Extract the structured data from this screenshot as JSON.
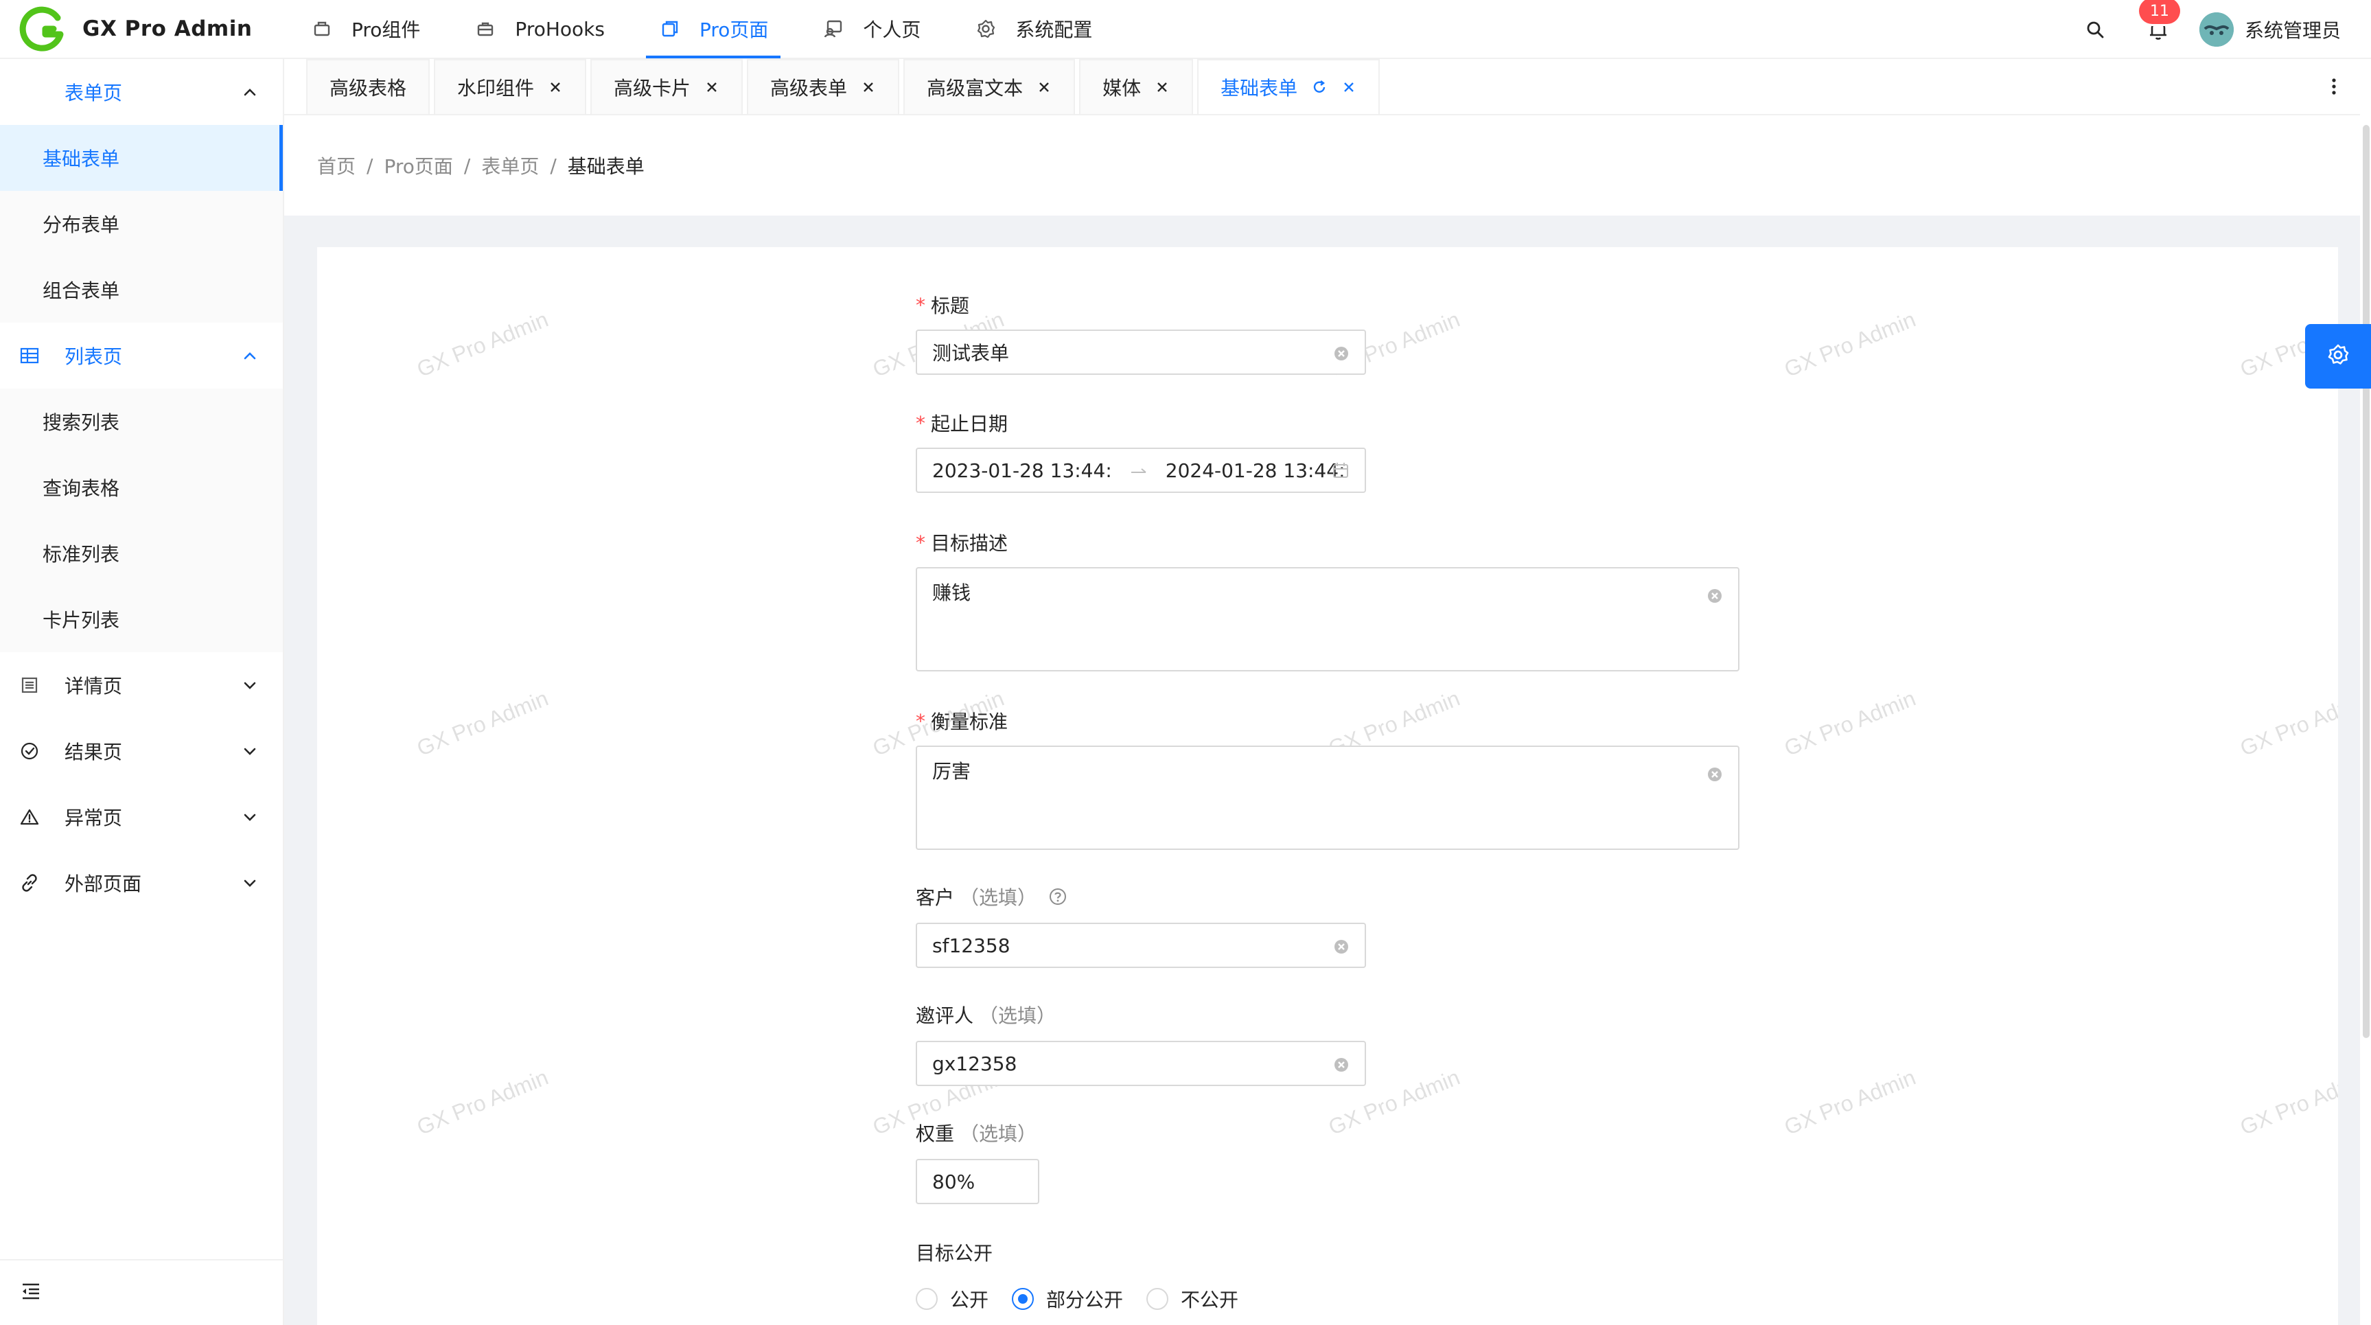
{
  "app": {
    "title": "GX Pro Admin",
    "accent_color": "#1677ff"
  },
  "topnav": [
    {
      "label": "Pro组件",
      "icon": "component-icon",
      "active": false
    },
    {
      "label": "ProHooks",
      "icon": "briefcase-icon",
      "active": false
    },
    {
      "label": "Pro页面",
      "icon": "pages-icon",
      "active": true
    },
    {
      "label": "个人页",
      "icon": "user-card-icon",
      "active": false
    },
    {
      "label": "系统配置",
      "icon": "gear-icon",
      "active": false
    }
  ],
  "header": {
    "notification_count": "11",
    "user_name": "系统管理员"
  },
  "sidebar": {
    "groups": [
      {
        "label": "表单页",
        "icon": "",
        "open": true,
        "items": [
          "基础表单",
          "分布表单",
          "组合表单"
        ],
        "selected": "基础表单"
      },
      {
        "label": "列表页",
        "icon": "table-icon",
        "open": true,
        "items": [
          "搜索列表",
          "查询表格",
          "标准列表",
          "卡片列表"
        ]
      },
      {
        "label": "详情页",
        "icon": "profile-icon",
        "open": false
      },
      {
        "label": "结果页",
        "icon": "check-circle-icon",
        "open": false
      },
      {
        "label": "异常页",
        "icon": "warning-icon",
        "open": false
      },
      {
        "label": "外部页面",
        "icon": "link-icon",
        "open": false
      }
    ]
  },
  "tabs": [
    {
      "label": "高级表格",
      "closable": false
    },
    {
      "label": "水印组件",
      "closable": true
    },
    {
      "label": "高级卡片",
      "closable": true
    },
    {
      "label": "高级表单",
      "closable": true
    },
    {
      "label": "高级富文本",
      "closable": true
    },
    {
      "label": "媒体",
      "closable": true
    },
    {
      "label": "基础表单",
      "closable": true,
      "active": true
    }
  ],
  "breadcrumb": [
    "首页",
    "Pro页面",
    "表单页",
    "基础表单"
  ],
  "form": {
    "title": {
      "label": "标题",
      "required": true,
      "value": "测试表单"
    },
    "date_range": {
      "label": "起止日期",
      "required": true,
      "start": "2023-01-28 13:44:",
      "end": "2024-01-28 13:44:"
    },
    "goal": {
      "label": "目标描述",
      "required": true,
      "value": "赚钱"
    },
    "standard": {
      "label": "衡量标准",
      "required": true,
      "value": "厉害"
    },
    "client": {
      "label": "客户",
      "optional": "（选填）",
      "value": "sf12358"
    },
    "invitee": {
      "label": "邀评人",
      "optional": "（选填）",
      "value": "gx12358"
    },
    "weight": {
      "label": "权重",
      "optional": "（选填）",
      "value": "80%"
    },
    "public": {
      "label": "目标公开",
      "options": [
        "公开",
        "部分公开",
        "不公开"
      ],
      "selected": "部分公开"
    }
  },
  "watermark": {
    "text": "GX Pro Admin"
  }
}
